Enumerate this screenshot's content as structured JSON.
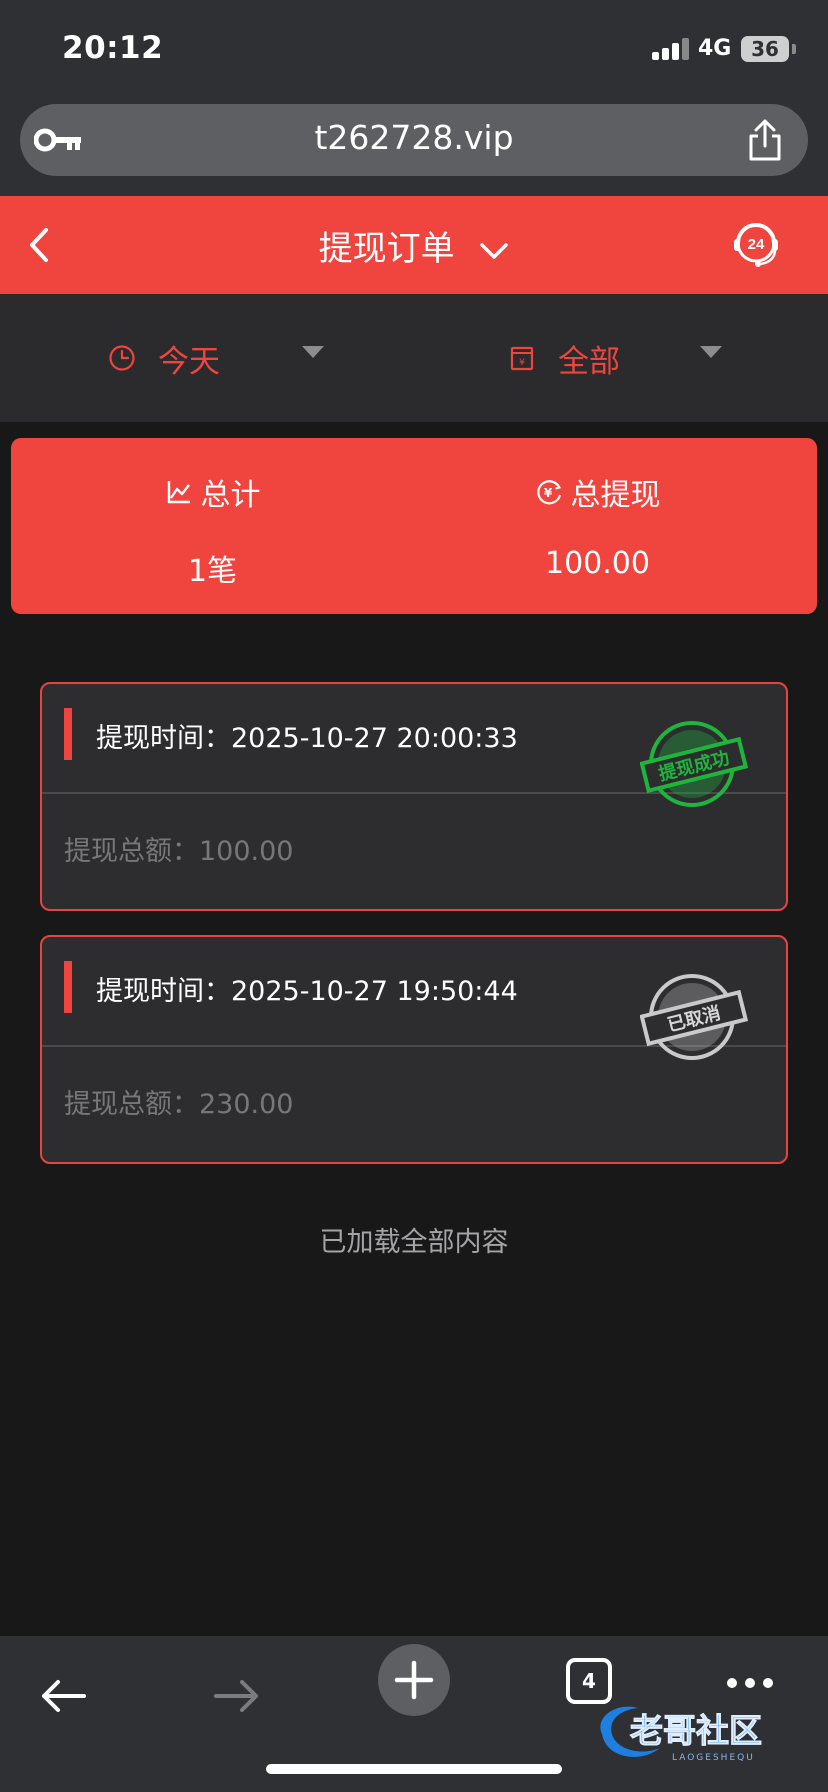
{
  "status_bar": {
    "time": "20:12",
    "network": "4G",
    "battery": "36"
  },
  "browser": {
    "url": "t262728.vip",
    "tab_count": "4"
  },
  "header": {
    "title": "提现订单",
    "support_label": "24"
  },
  "filters": {
    "date": "今天",
    "category": "全部"
  },
  "summary": {
    "total_label": "总计",
    "total_value": "1笔",
    "withdraw_label": "总提现",
    "withdraw_value": "100.00"
  },
  "orders": [
    {
      "time_label": "提现时间：",
      "time": "2025-10-27 20:00:33",
      "amount_label": "提现总额：",
      "amount": "100.00",
      "status": "提现成功",
      "status_color": "#1fb43c"
    },
    {
      "time_label": "提现时间：",
      "time": "2025-10-27 19:50:44",
      "amount_label": "提现总额：",
      "amount": "230.00",
      "status": "已取消",
      "status_color": "#c9c9c9"
    }
  ],
  "footer_text": "已加载全部内容",
  "watermark": {
    "text": "老哥社区",
    "sub": "LAOGESHEQU"
  },
  "colors": {
    "accent": "#f0453e",
    "background": "#181818",
    "card": "#2d2d30"
  }
}
